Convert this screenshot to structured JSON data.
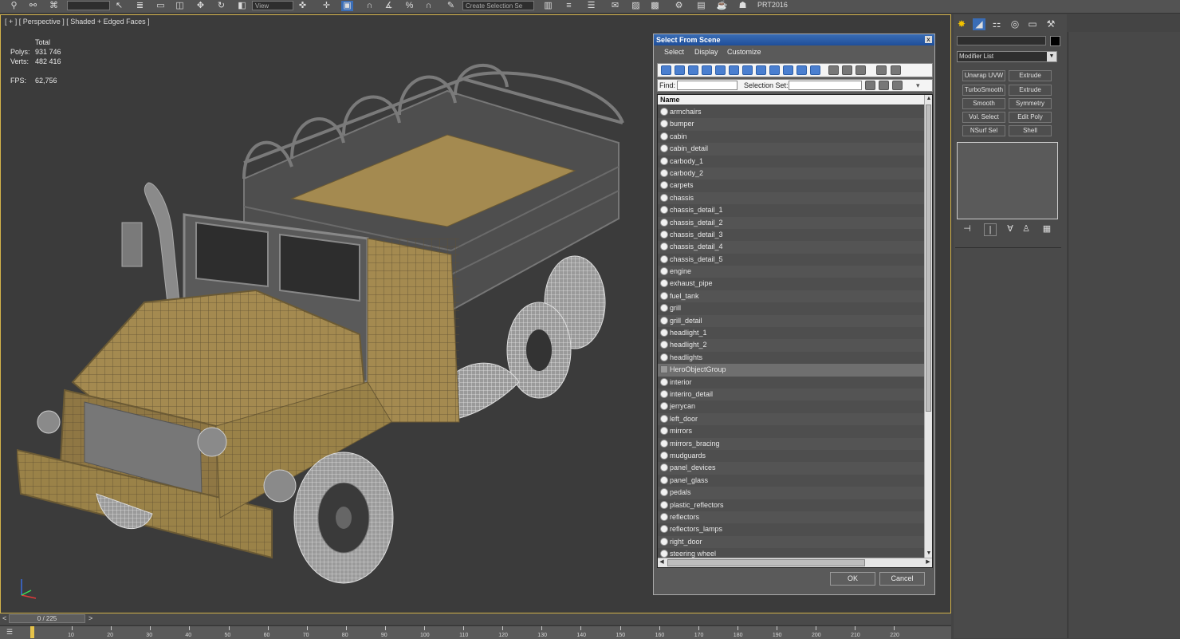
{
  "toolbar": {
    "view_combo": "View",
    "selection_set_combo": "Create Selection Se",
    "project": "PRT2016"
  },
  "viewport": {
    "label": "[ + ] [ Perspective ] [ Shaded + Edged Faces ]",
    "stats": {
      "total_label": "Total",
      "polys_label": "Polys:",
      "polys_value": "931 746",
      "verts_label": "Verts:",
      "verts_value": "482 416",
      "fps_label": "FPS:",
      "fps_value": "62,756"
    }
  },
  "dialog": {
    "title": "Select From Scene",
    "close": "x",
    "menus": [
      "Select",
      "Display",
      "Customize"
    ],
    "find_label": "Find:",
    "find_value": "",
    "selection_set_label": "Selection Set:",
    "selection_set_value": "",
    "column_header": "Name",
    "items": [
      {
        "name": "armchairs"
      },
      {
        "name": "bumper"
      },
      {
        "name": "cabin"
      },
      {
        "name": "cabin_detail"
      },
      {
        "name": "carbody_1"
      },
      {
        "name": "carbody_2"
      },
      {
        "name": "carpets"
      },
      {
        "name": "chassis"
      },
      {
        "name": "chassis_detail_1"
      },
      {
        "name": "chassis_detail_2"
      },
      {
        "name": "chassis_detail_3"
      },
      {
        "name": "chassis_detail_4"
      },
      {
        "name": "chassis_detail_5"
      },
      {
        "name": "engine"
      },
      {
        "name": "exhaust_pipe"
      },
      {
        "name": "fuel_tank"
      },
      {
        "name": "grill"
      },
      {
        "name": "grill_detail"
      },
      {
        "name": "headlight_1"
      },
      {
        "name": "headlight_2"
      },
      {
        "name": "headlights"
      },
      {
        "name": "HeroObjectGroup",
        "group": true,
        "selected": true
      },
      {
        "name": "interior"
      },
      {
        "name": "interiro_detail"
      },
      {
        "name": "jerrycan"
      },
      {
        "name": "left_door"
      },
      {
        "name": "mirrors"
      },
      {
        "name": "mirrors_bracing"
      },
      {
        "name": "mudguards"
      },
      {
        "name": "panel_devices"
      },
      {
        "name": "panel_glass"
      },
      {
        "name": "pedals"
      },
      {
        "name": "plastic_reflectors"
      },
      {
        "name": "reflectors"
      },
      {
        "name": "reflectors_lamps"
      },
      {
        "name": "right_door"
      },
      {
        "name": "steering wheel"
      }
    ],
    "ok_label": "OK",
    "cancel_label": "Cancel"
  },
  "command_panel": {
    "modifier_list": "Modifier List",
    "buttons": [
      [
        "Unwrap UVW",
        "Extrude"
      ],
      [
        "TurboSmooth",
        "Extrude"
      ],
      [
        "Smooth",
        "Symmetry"
      ],
      [
        "Vol. Select",
        "Edit Poly"
      ],
      [
        "NSurf Sel",
        "Shell"
      ]
    ]
  },
  "timeline": {
    "slider": "0 / 225",
    "prev": "<",
    "next": ">",
    "ticks": [
      "10",
      "20",
      "30",
      "40",
      "50",
      "60",
      "70",
      "80",
      "90",
      "100",
      "110",
      "120",
      "130",
      "140",
      "150",
      "160",
      "170",
      "180",
      "190",
      "200",
      "210",
      "220"
    ]
  },
  "colors": {
    "viewport_border": "#d2b24a",
    "stats_text": "#ffd54a",
    "dialog_title": "#1f4f9a",
    "truck_body": "#a48a50"
  }
}
